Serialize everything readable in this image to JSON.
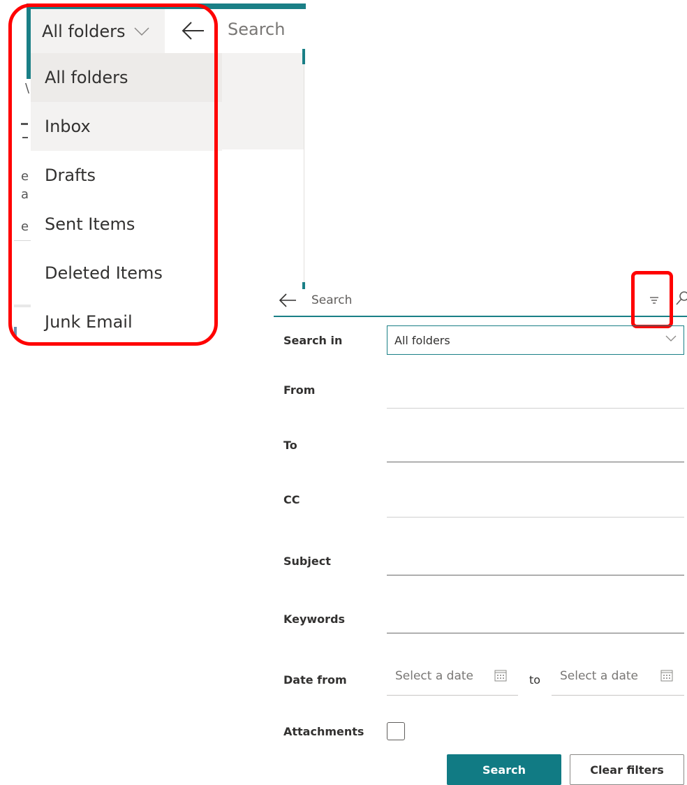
{
  "folder_picker": {
    "selected_label": "All folders",
    "search_placeholder": "Search",
    "items": [
      {
        "label": "All folders"
      },
      {
        "label": "Inbox"
      },
      {
        "label": "Drafts"
      },
      {
        "label": "Sent Items"
      },
      {
        "label": "Deleted Items"
      },
      {
        "label": "Junk Email"
      }
    ]
  },
  "advanced_search": {
    "search_placeholder": "Search",
    "labels": {
      "search_in": "Search in",
      "from": "From",
      "to": "To",
      "cc": "CC",
      "subject": "Subject",
      "keywords": "Keywords",
      "date_from": "Date from",
      "attachments": "Attachments"
    },
    "search_in_value": "All folders",
    "date_placeholder": "Select a date",
    "to_connector": "to",
    "search_button": "Search",
    "clear_button": "Clear filters"
  },
  "colors": {
    "accent": "#1a7f86",
    "primary_button": "#117b84",
    "highlight": "#ff0000"
  },
  "icons": [
    "chevron-down-icon",
    "back-arrow-icon",
    "filter-icon",
    "search-icon",
    "calendar-icon"
  ]
}
